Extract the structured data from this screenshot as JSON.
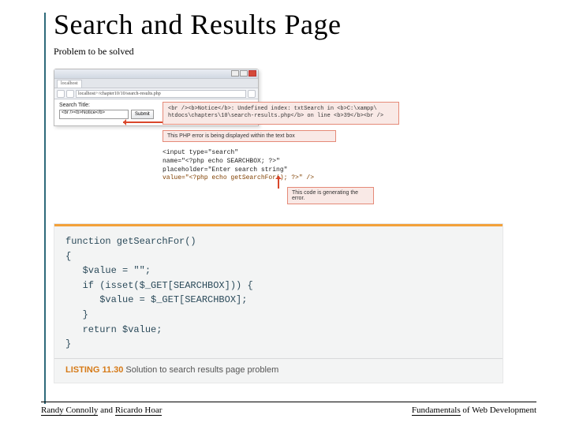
{
  "title": "Search and Results Page",
  "subtitle": "Problem to be solved",
  "browser": {
    "tab": "localhost",
    "address": "localhost/~/chapter10/10/search-results.php",
    "label": "Search Title:",
    "search_value": "<br /><b>Notice</b>",
    "submit": "Submit"
  },
  "callouts": {
    "notice_line1": "<br /><b>Notice</b>:  Undefined index: txtSearch in <b>C:\\xampp\\",
    "notice_line2": "htdocs\\chapters\\10\\search-results.php</b> on line <b>39</b><br />",
    "note1": "This PHP error is being displayed within the text box",
    "note2": "This code is generating the error."
  },
  "code_input": {
    "l1": "<input type=\"search\"",
    "l2": "       name=\"<?php echo SEARCHBOX; ?>\"",
    "l3": "       placeholder=\"Enter search string\"",
    "l4": "       value=\"<?php echo getSearchFor(); ?>\"  />"
  },
  "listing": {
    "l1": "function getSearchFor()",
    "l2": "{",
    "l3": "   $value = \"\";",
    "l4": "   if (isset($_GET[SEARCHBOX])) {",
    "l5": "      $value = $_GET[SEARCHBOX];",
    "l6": "   }",
    "l7": "   return $value;",
    "l8": "}",
    "caption_num": "LISTING 11.30",
    "caption_text": " Solution to search results page problem"
  },
  "footer": {
    "author1": "Randy Connolly",
    "and": " and ",
    "author2": "Ricardo Hoar",
    "right1": "Fundamentals",
    "right2": " of Web Development"
  }
}
